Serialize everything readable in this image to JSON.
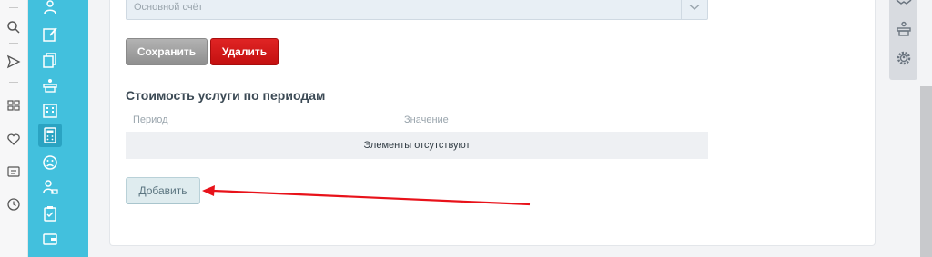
{
  "form": {
    "account_select_value": "Основной счёт",
    "save_label": "Сохранить",
    "delete_label": "Удалить",
    "section_title": "Стоимость услуги по периодам",
    "table": {
      "columns": [
        "Период",
        "Значение"
      ],
      "empty_text": "Элементы отсутствуют"
    },
    "add_label": "Добавить"
  },
  "colors": {
    "sidebar": "#42c0dd",
    "delete_button": "#d41a1a",
    "save_button": "#a2a2a2",
    "annotation_arrow": "#e8121a"
  },
  "left_rail_icons": [
    "search-icon",
    "send-icon",
    "grid-icon",
    "heart-icon",
    "message-icon",
    "clock-icon"
  ],
  "sidebar_icons": [
    "users-icon",
    "edit-icon",
    "documents-icon",
    "reception-icon",
    "building-icon",
    "calculator-icon",
    "sad-face-icon",
    "group-icon",
    "clipboard-icon",
    "wallet-icon"
  ],
  "right_panel_icons": [
    "handshake-icon",
    "reception-icon",
    "settings-gear-icon"
  ]
}
